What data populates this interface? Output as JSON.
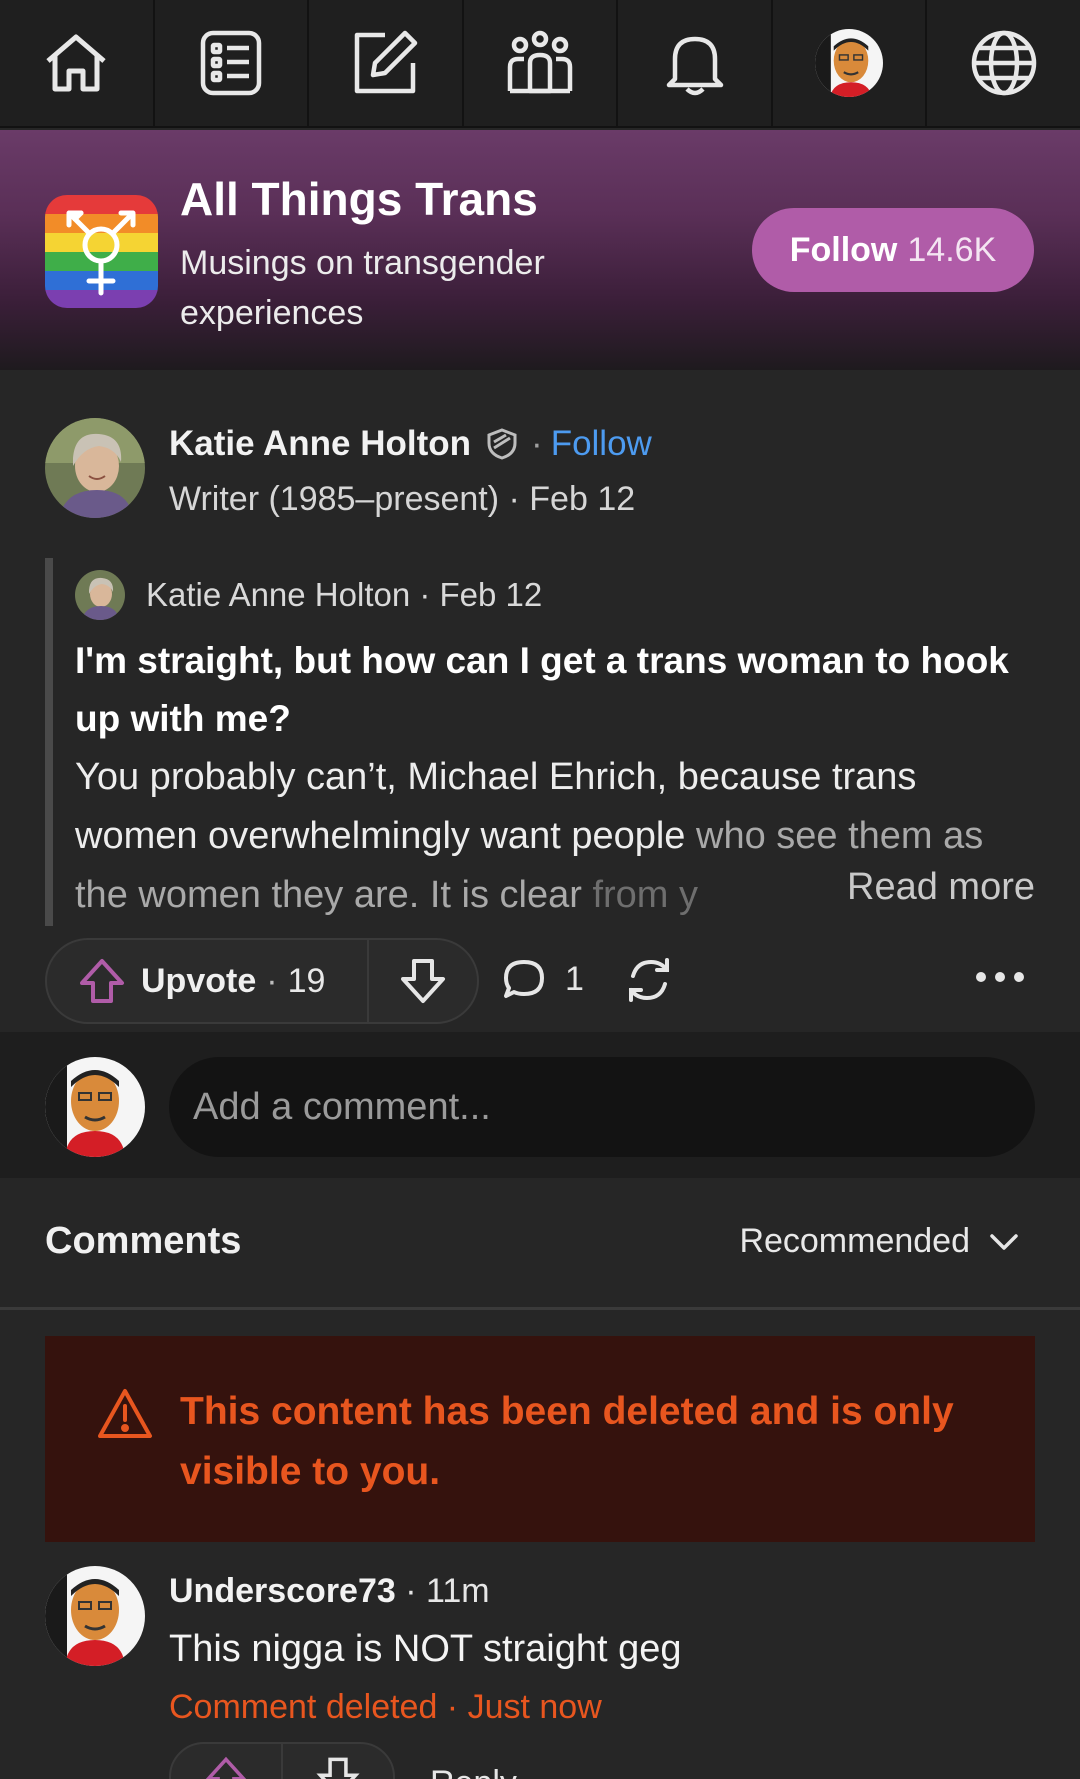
{
  "nav": {
    "items": [
      {
        "name": "home-icon"
      },
      {
        "name": "answer-list-icon"
      },
      {
        "name": "edit-icon"
      },
      {
        "name": "spaces-icon"
      },
      {
        "name": "bell-icon"
      },
      {
        "name": "profile-avatar"
      },
      {
        "name": "globe-icon"
      }
    ]
  },
  "space": {
    "title": "All Things Trans",
    "subtitle": "Musings on transgender experiences",
    "follow_label": "Follow",
    "follower_count": "14.6K",
    "accent": "#b05ca8"
  },
  "post": {
    "author": "Katie Anne Holton",
    "follow_label": "Follow",
    "dot": "·",
    "credential": "Writer (1985–present) · Feb 12",
    "quoted": {
      "author_line": "Katie Anne Holton · Feb 12",
      "title": "I'm straight, but how can I get a trans woman to hook up with me?",
      "body_main": "You probably can’t, Michael Ehrich, because trans women overwhelmingly want people ",
      "body_fade": "who see them as the women they are. It is clear ",
      "body_fade2": "from y",
      "read_more": "Read more"
    },
    "actions": {
      "upvote_label": "Upvote",
      "separator": "·",
      "upvote_count": "19",
      "comment_count": "1"
    }
  },
  "add_comment": {
    "placeholder": "Add a comment..."
  },
  "comments": {
    "title": "Comments",
    "sort_label": "Recommended"
  },
  "deleted_notice": {
    "text": "This content has been deleted and is only visible to you."
  },
  "comment": {
    "author": "Underscore73",
    "time": " · 11m",
    "text": "This nigga is NOT straight geg",
    "status": "Comment deleted · Just now",
    "reply_label": "Reply"
  },
  "colors": {
    "background": "#262626",
    "link_blue": "#4d9bf0",
    "deleted_orange": "#e8561f",
    "deleted_bg": "#35120d"
  }
}
